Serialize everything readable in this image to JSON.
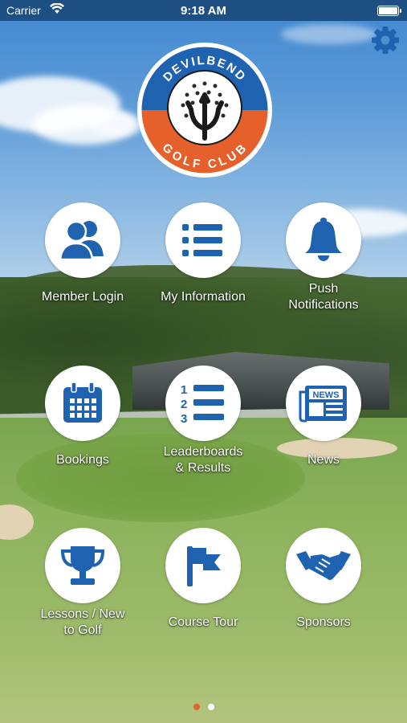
{
  "status_bar": {
    "carrier": "Carrier",
    "time": "9:18 AM"
  },
  "logo": {
    "top_text": "DEVILBEND",
    "bottom_text": "GOLF CLUB",
    "colors": {
      "blue": "#1e62b0",
      "orange": "#e5602a"
    }
  },
  "settings": {
    "icon": "gear-icon"
  },
  "tiles": [
    {
      "label": "Member Login",
      "icon": "members-icon"
    },
    {
      "label": "My Information",
      "icon": "list-icon"
    },
    {
      "label": "Push\nNotifications",
      "icon": "bell-icon"
    },
    {
      "label": "Bookings",
      "icon": "calendar-icon"
    },
    {
      "label": "Leaderboards\n& Results",
      "icon": "numbered-list-icon"
    },
    {
      "label": "News",
      "icon": "newspaper-icon"
    },
    {
      "label": "Lessons / New\nto Golf",
      "icon": "trophy-icon"
    },
    {
      "label": "Course Tour",
      "icon": "flag-icon"
    },
    {
      "label": "Sponsors",
      "icon": "handshake-icon"
    }
  ],
  "pager": {
    "pages": 2,
    "current": 1
  },
  "theme": {
    "icon_color": "#1e62b0",
    "status_bar": "#1e4f82",
    "accent": "#e5602a"
  }
}
